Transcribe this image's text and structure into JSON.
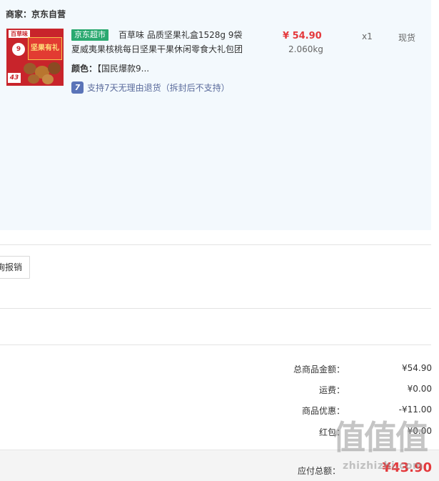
{
  "seller": {
    "label": "商家：京东自营"
  },
  "product": {
    "tag": "京东超市",
    "title_line1": "百草味 品质坚果礼盒1528g 9袋",
    "title_line2": "夏威夷果核桃每日坚果干果休闲零食大礼包团",
    "color_label": "颜色：",
    "color_value": "【国民爆款9...",
    "return_icon": "7",
    "return_text": "支持7天无理由退货（拆封后不支持）",
    "price": "¥ 54.90",
    "weight": "2.060kg",
    "quantity": "x1",
    "stock": "现货",
    "thumb": {
      "brand": "百草味",
      "box_text": "坚果有礼",
      "nine": "9",
      "badge": "43"
    }
  },
  "invoice": {
    "button_label": "询报销"
  },
  "summary": {
    "rows": [
      {
        "key": "总商品金额：",
        "value": "¥54.90"
      },
      {
        "key": "运费：",
        "value": "¥0.00"
      },
      {
        "key": "商品优惠：",
        "value": "-¥11.00"
      },
      {
        "key": "红包：",
        "value": "¥0.00"
      }
    ],
    "total_key": "应付总额：",
    "total_value": "¥43.90"
  },
  "watermark": {
    "big": "值值值",
    "small": "zhizhizhi.com"
  },
  "colors": {
    "accent_red": "#e4393c",
    "tag_green": "#2aa970",
    "panel_bg": "#f3f9fd",
    "return_blue": "#5a74b8"
  },
  "icons": {
    "return": "seven-day-return-icon"
  }
}
